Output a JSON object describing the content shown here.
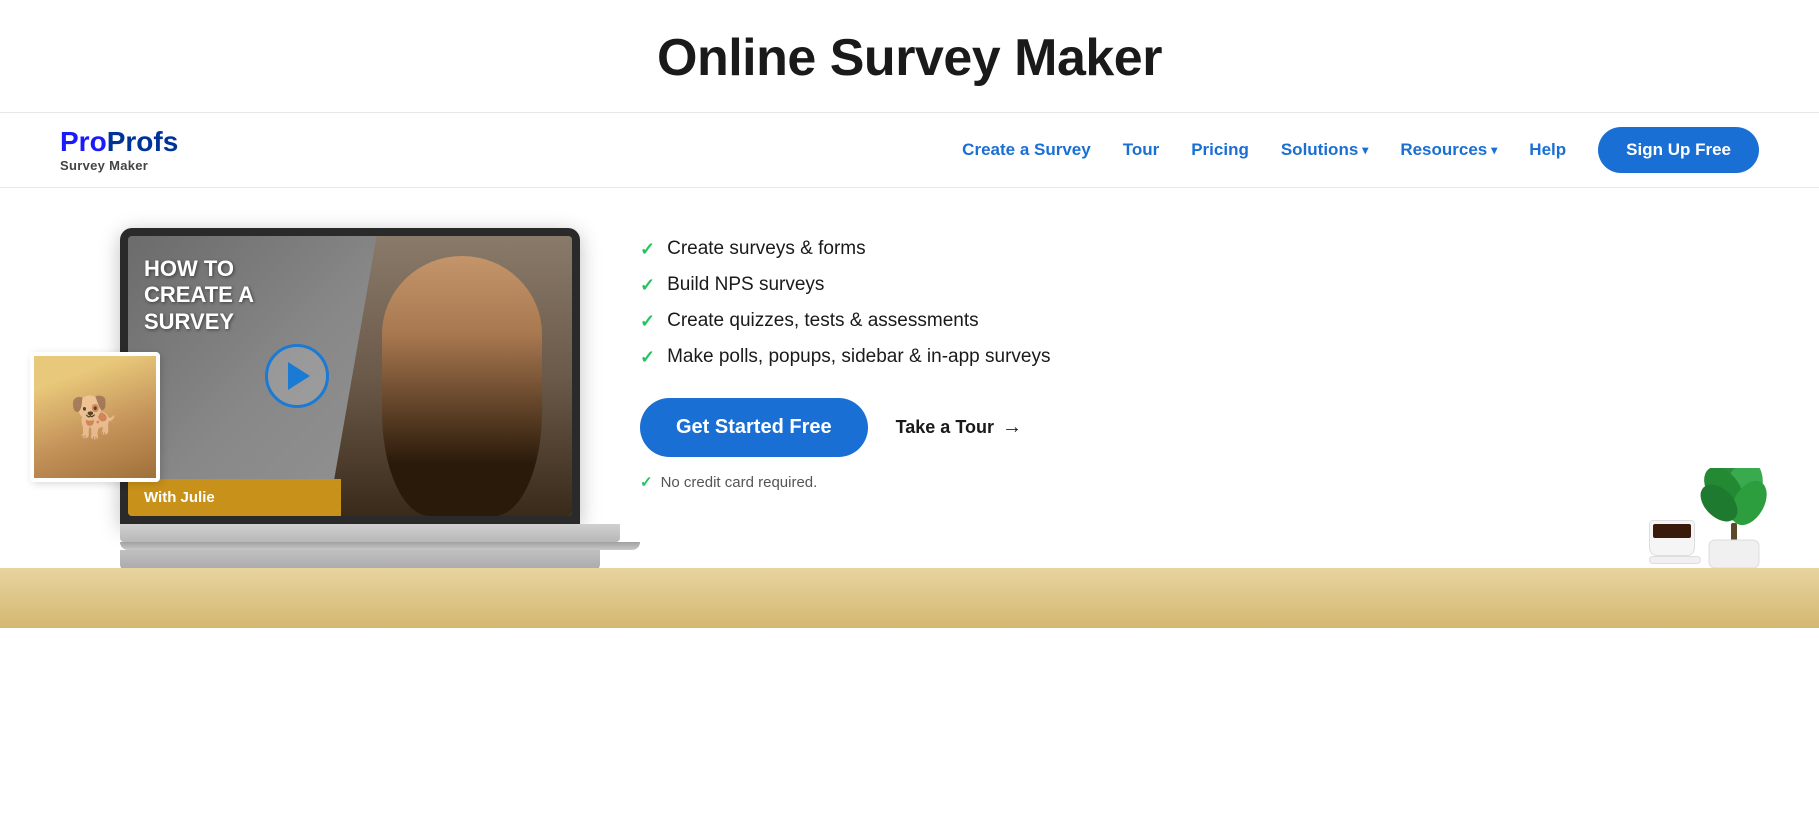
{
  "page": {
    "top_title": "Online Survey Maker"
  },
  "logo": {
    "pro": "Pro",
    "profs": "Profs",
    "subtitle": "Survey Maker"
  },
  "nav": {
    "links": [
      {
        "label": "Create a Survey",
        "id": "create-survey",
        "has_arrow": false
      },
      {
        "label": "Tour",
        "id": "tour",
        "has_arrow": false
      },
      {
        "label": "Pricing",
        "id": "pricing",
        "has_arrow": false
      },
      {
        "label": "Solutions",
        "id": "solutions",
        "has_arrow": true
      },
      {
        "label": "Resources",
        "id": "resources",
        "has_arrow": true
      },
      {
        "label": "Help",
        "id": "help",
        "has_arrow": false
      }
    ],
    "signup_label": "Sign Up Free"
  },
  "video": {
    "title_line1": "HOW TO",
    "title_line2": "CREATE A",
    "title_line3": "SURVEY",
    "with_label": "With Julie"
  },
  "hero": {
    "features": [
      "Create surveys & forms",
      "Build NPS surveys",
      "Create quizzes, tests & assessments",
      "Make polls, popups, sidebar & in-app surveys"
    ],
    "get_started_label": "Get Started Free",
    "tour_label": "Take a Tour",
    "no_cc_text": "No credit card required."
  }
}
